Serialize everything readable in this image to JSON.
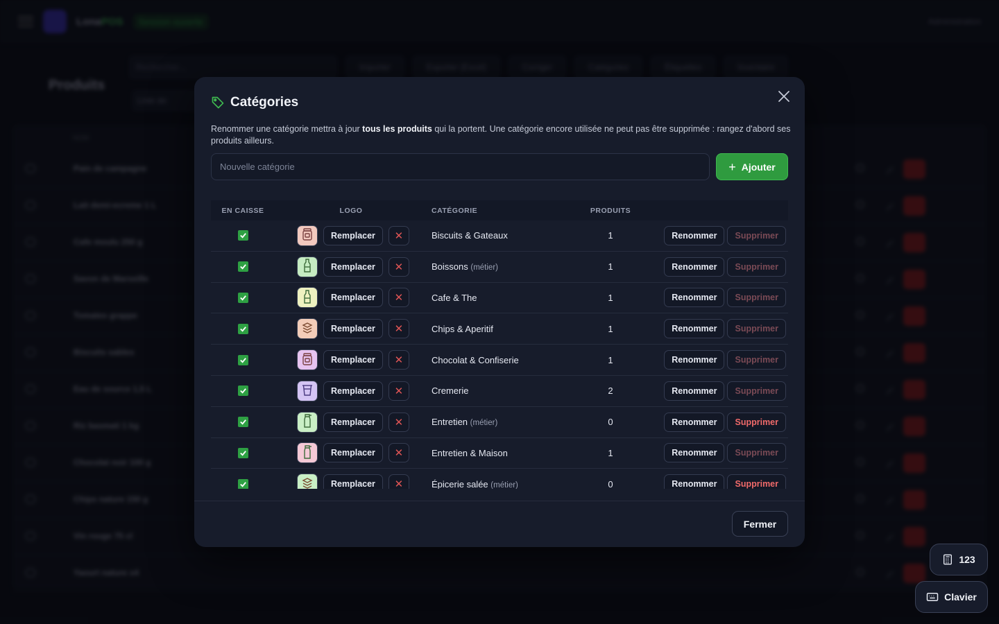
{
  "background": {
    "brand": "Lona",
    "brand_suffix": "POS",
    "status_chip": "Session ouverte",
    "user": "Administration",
    "search_placeholder": "Rechercher...",
    "toolbar": [
      "Importer",
      "Exporter (Excel)",
      "Corriger",
      "Catégories",
      "Étiquettes",
      "Inventaire"
    ],
    "page_title": "Produits",
    "list_button": "Liste de",
    "column_nom": "NOM",
    "rows": [
      "Pain de campagne",
      "Lait demi-ecreme 1 L",
      "Cafe moulu 250 g",
      "Savon de Marseille",
      "Tomates grappe",
      "Biscuits sables",
      "Eau de source 1,5 L",
      "Riz basmati 1 kg",
      "Chocolat noir 100 g",
      "Chips nature 150 g",
      "Vin rouge 75 cl",
      "Yaourt nature x4"
    ]
  },
  "modal": {
    "title": "Catégories",
    "description_pre": "Renommer une catégorie mettra à jour ",
    "description_bold": "tous les produits",
    "description_post": " qui la portent. Une catégorie encore utilisée ne peut pas être supprimée : rangez d'abord ses produits ailleurs.",
    "input_placeholder": "Nouvelle catégorie",
    "add_label": "Ajouter",
    "headers": {
      "caisse": "EN CAISSE",
      "logo": "LOGO",
      "category": "CATÉGORIE",
      "products": "PRODUITS"
    },
    "replace_label": "Remplacer",
    "rename_label": "Renommer",
    "delete_label": "Supprimer",
    "close_label": "Fermer",
    "rows": [
      {
        "name": "Biscuits & Gateaux",
        "tag": "",
        "count": "1",
        "bg": "#f2c9bf",
        "icon": "jar-icon",
        "deletable": false
      },
      {
        "name": "Boissons",
        "tag": "(métier)",
        "count": "1",
        "bg": "#c6ecc2",
        "icon": "bottle-icon",
        "deletable": false
      },
      {
        "name": "Cafe & The",
        "tag": "",
        "count": "1",
        "bg": "#eef1c0",
        "icon": "bottle-icon",
        "deletable": false
      },
      {
        "name": "Chips & Aperitif",
        "tag": "",
        "count": "1",
        "bg": "#f3cdb9",
        "icon": "stack-icon",
        "deletable": false
      },
      {
        "name": "Chocolat & Confiserie",
        "tag": "",
        "count": "1",
        "bg": "#e7c4f0",
        "icon": "jar-icon",
        "deletable": false
      },
      {
        "name": "Cremerie",
        "tag": "",
        "count": "2",
        "bg": "#d4c4f4",
        "icon": "cup-icon",
        "deletable": false
      },
      {
        "name": "Entretien",
        "tag": "(métier)",
        "count": "0",
        "bg": "#c9efc5",
        "icon": "spray-icon",
        "deletable": true
      },
      {
        "name": "Entretien & Maison",
        "tag": "",
        "count": "1",
        "bg": "#f5c9d6",
        "icon": "spray-icon",
        "deletable": false
      },
      {
        "name": "Épicerie salée",
        "tag": "(métier)",
        "count": "0",
        "bg": "#c9efc5",
        "icon": "stack-icon",
        "deletable": true
      }
    ]
  },
  "floating": {
    "numpad_label": "123",
    "keyboard_label": "Clavier"
  },
  "colors": {
    "accent_green": "#2ea043",
    "danger": "#e05555",
    "modal_bg": "#171c2b"
  }
}
